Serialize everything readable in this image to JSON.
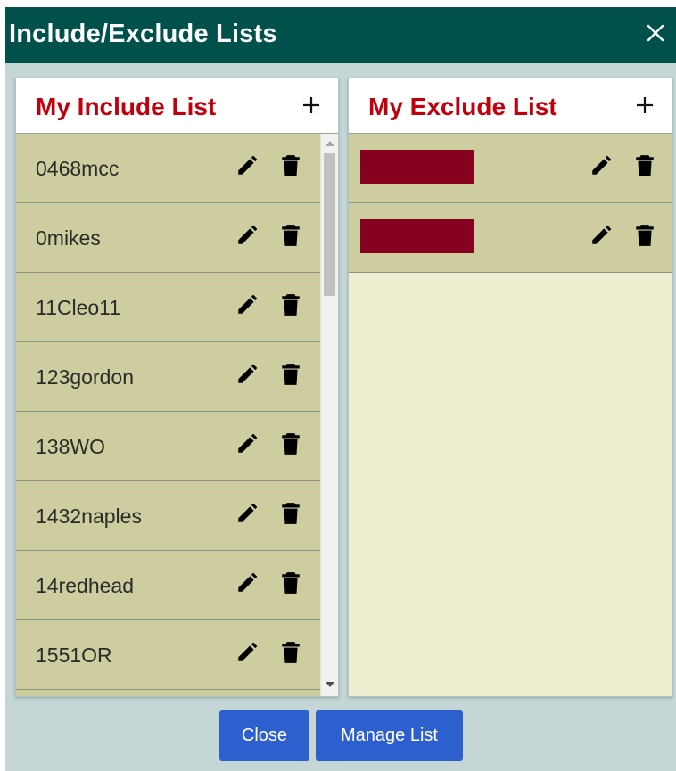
{
  "dialog": {
    "title": "Include/Exclude Lists",
    "close_icon": "close-icon"
  },
  "include_panel": {
    "title": "My Include List",
    "add_icon": "plus-icon",
    "items": [
      {
        "label": "0468mcc"
      },
      {
        "label": "0mikes"
      },
      {
        "label": "11Cleo11"
      },
      {
        "label": "123gordon"
      },
      {
        "label": "138WO"
      },
      {
        "label": "1432naples"
      },
      {
        "label": "14redhead"
      },
      {
        "label": "1551OR"
      },
      {
        "label": ""
      }
    ]
  },
  "exclude_panel": {
    "title": "My Exclude List",
    "add_icon": "plus-icon",
    "items": [
      {
        "redacted": true
      },
      {
        "redacted": true
      }
    ]
  },
  "icons": {
    "edit": "pencil-icon",
    "delete": "trash-icon"
  },
  "footer": {
    "close_label": "Close",
    "manage_label": "Manage List"
  },
  "colors": {
    "titlebar": "#00504c",
    "panel_title": "#c0000c",
    "row_bg": "#cdcd9f",
    "list_bg": "#eeedcf",
    "redaction": "#860020",
    "button": "#2e5fcf"
  }
}
